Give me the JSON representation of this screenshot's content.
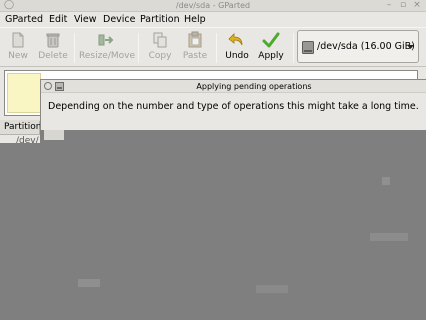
{
  "window": {
    "title": "/dev/sda - GParted"
  },
  "menubar": {
    "items": [
      "GParted",
      "Edit",
      "View",
      "Device",
      "Partition",
      "Help"
    ]
  },
  "toolbar": {
    "new_label": "New",
    "delete_label": "Delete",
    "resize_move_label": "Resize/Move",
    "copy_label": "Copy",
    "paste_label": "Paste",
    "undo_label": "Undo",
    "apply_label": "Apply"
  },
  "device_selector": {
    "value": "/dev/sda  (16.00 GiB)"
  },
  "partition_table": {
    "columns": [
      "Partition"
    ],
    "rows": [
      {
        "partition": "/dev/"
      }
    ]
  },
  "dialog": {
    "title": "Applying pending operations",
    "message": "Depending on the number and type of operations this might take a long time."
  },
  "colors": {
    "unallocated": "#f9f6c4",
    "apply_green": "#4caa2c",
    "undo_yellow": "#e3b21c",
    "overlay": "#7f7f7f"
  }
}
